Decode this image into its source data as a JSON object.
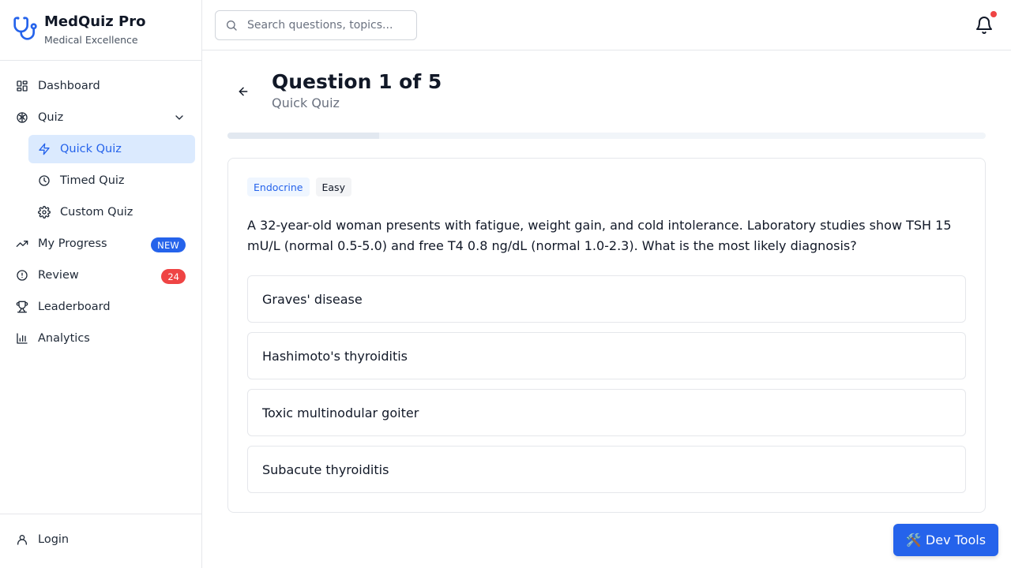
{
  "brand": {
    "title": "MedQuiz Pro",
    "subtitle": "Medical Excellence",
    "accent": "#2563eb"
  },
  "sidebar": {
    "items": [
      {
        "label": "Dashboard",
        "icon": "dashboard-icon"
      },
      {
        "label": "Quiz",
        "icon": "brain-icon",
        "expanded": true
      },
      {
        "label": "Quick Quiz",
        "icon": "lightning-icon",
        "active": true
      },
      {
        "label": "Timed Quiz",
        "icon": "clock-icon"
      },
      {
        "label": "Custom Quiz",
        "icon": "gear-icon"
      },
      {
        "label": "My Progress",
        "icon": "trending-up-icon",
        "badge": "NEW"
      },
      {
        "label": "Review",
        "icon": "alert-circle-icon",
        "badge": "24"
      },
      {
        "label": "Leaderboard",
        "icon": "trophy-icon"
      },
      {
        "label": "Analytics",
        "icon": "bar-chart-icon"
      }
    ],
    "footer": {
      "login_label": "Login",
      "icon": "user-icon"
    }
  },
  "header": {
    "search_placeholder": "Search questions, topics...",
    "notification_icon": "bell-icon",
    "has_notification": true
  },
  "main": {
    "title": "Question 1 of 5",
    "subtitle": "Quick Quiz",
    "progress": 0.2,
    "tags": [
      "Endocrine",
      "Easy"
    ],
    "question": "A 32-year-old woman presents with fatigue, weight gain, and cold intolerance. Laboratory studies show TSH 15 mU/L (normal 0.5-5.0) and free T4 0.8 ng/dL (normal 1.0-2.3). What is the most likely diagnosis?",
    "options": [
      "Graves' disease",
      "Hashimoto's thyroiditis",
      "Toxic multinodular goiter",
      "Subacute thyroiditis"
    ]
  },
  "devtools": {
    "label": "🛠️ Dev Tools"
  }
}
